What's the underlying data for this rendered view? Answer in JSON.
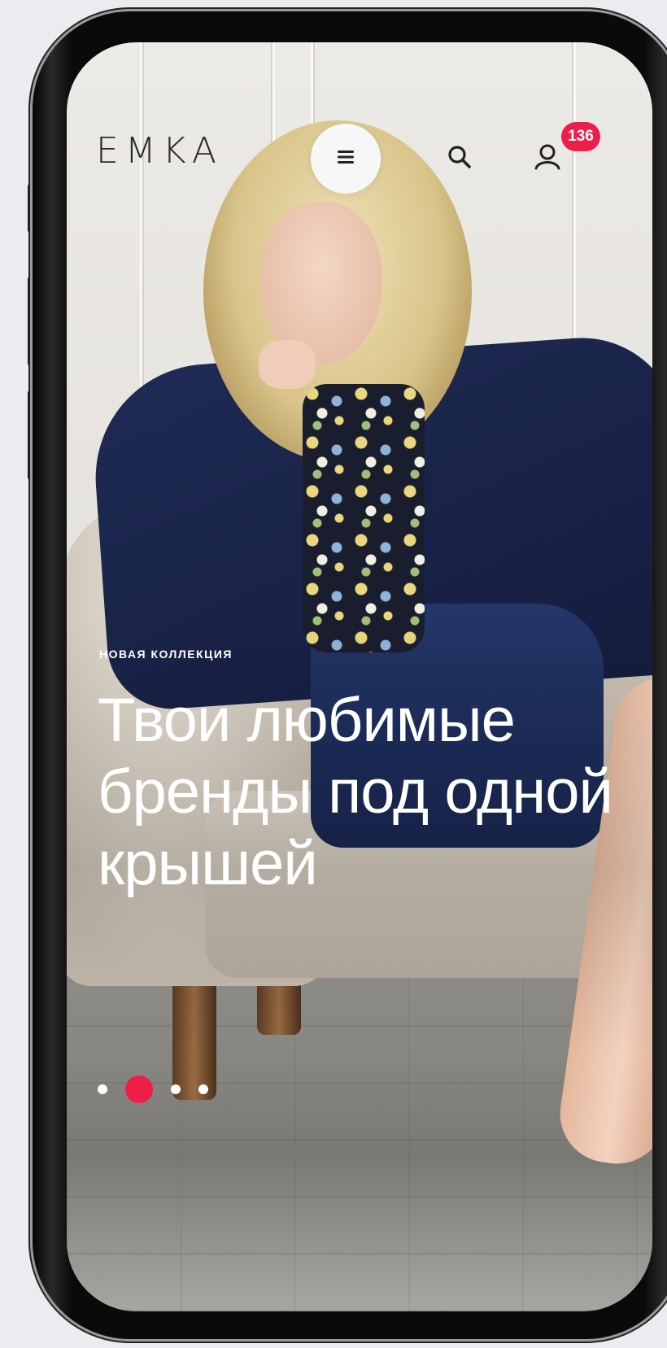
{
  "header": {
    "logo": "EMKA",
    "menu_icon": "hamburger-icon",
    "search_icon": "search-icon",
    "account_icon": "user-icon",
    "account_badge": "136"
  },
  "hero": {
    "eyebrow": "НОВАЯ КОЛЛЕКЦИЯ",
    "headline": "Твои любимые бренды под одной крышей"
  },
  "carousel": {
    "total_slides": 4,
    "active_slide": 2
  },
  "colors": {
    "accent": "#ef1d4a",
    "logo": "#2b2b2b",
    "hero_text": "#ffffff"
  }
}
